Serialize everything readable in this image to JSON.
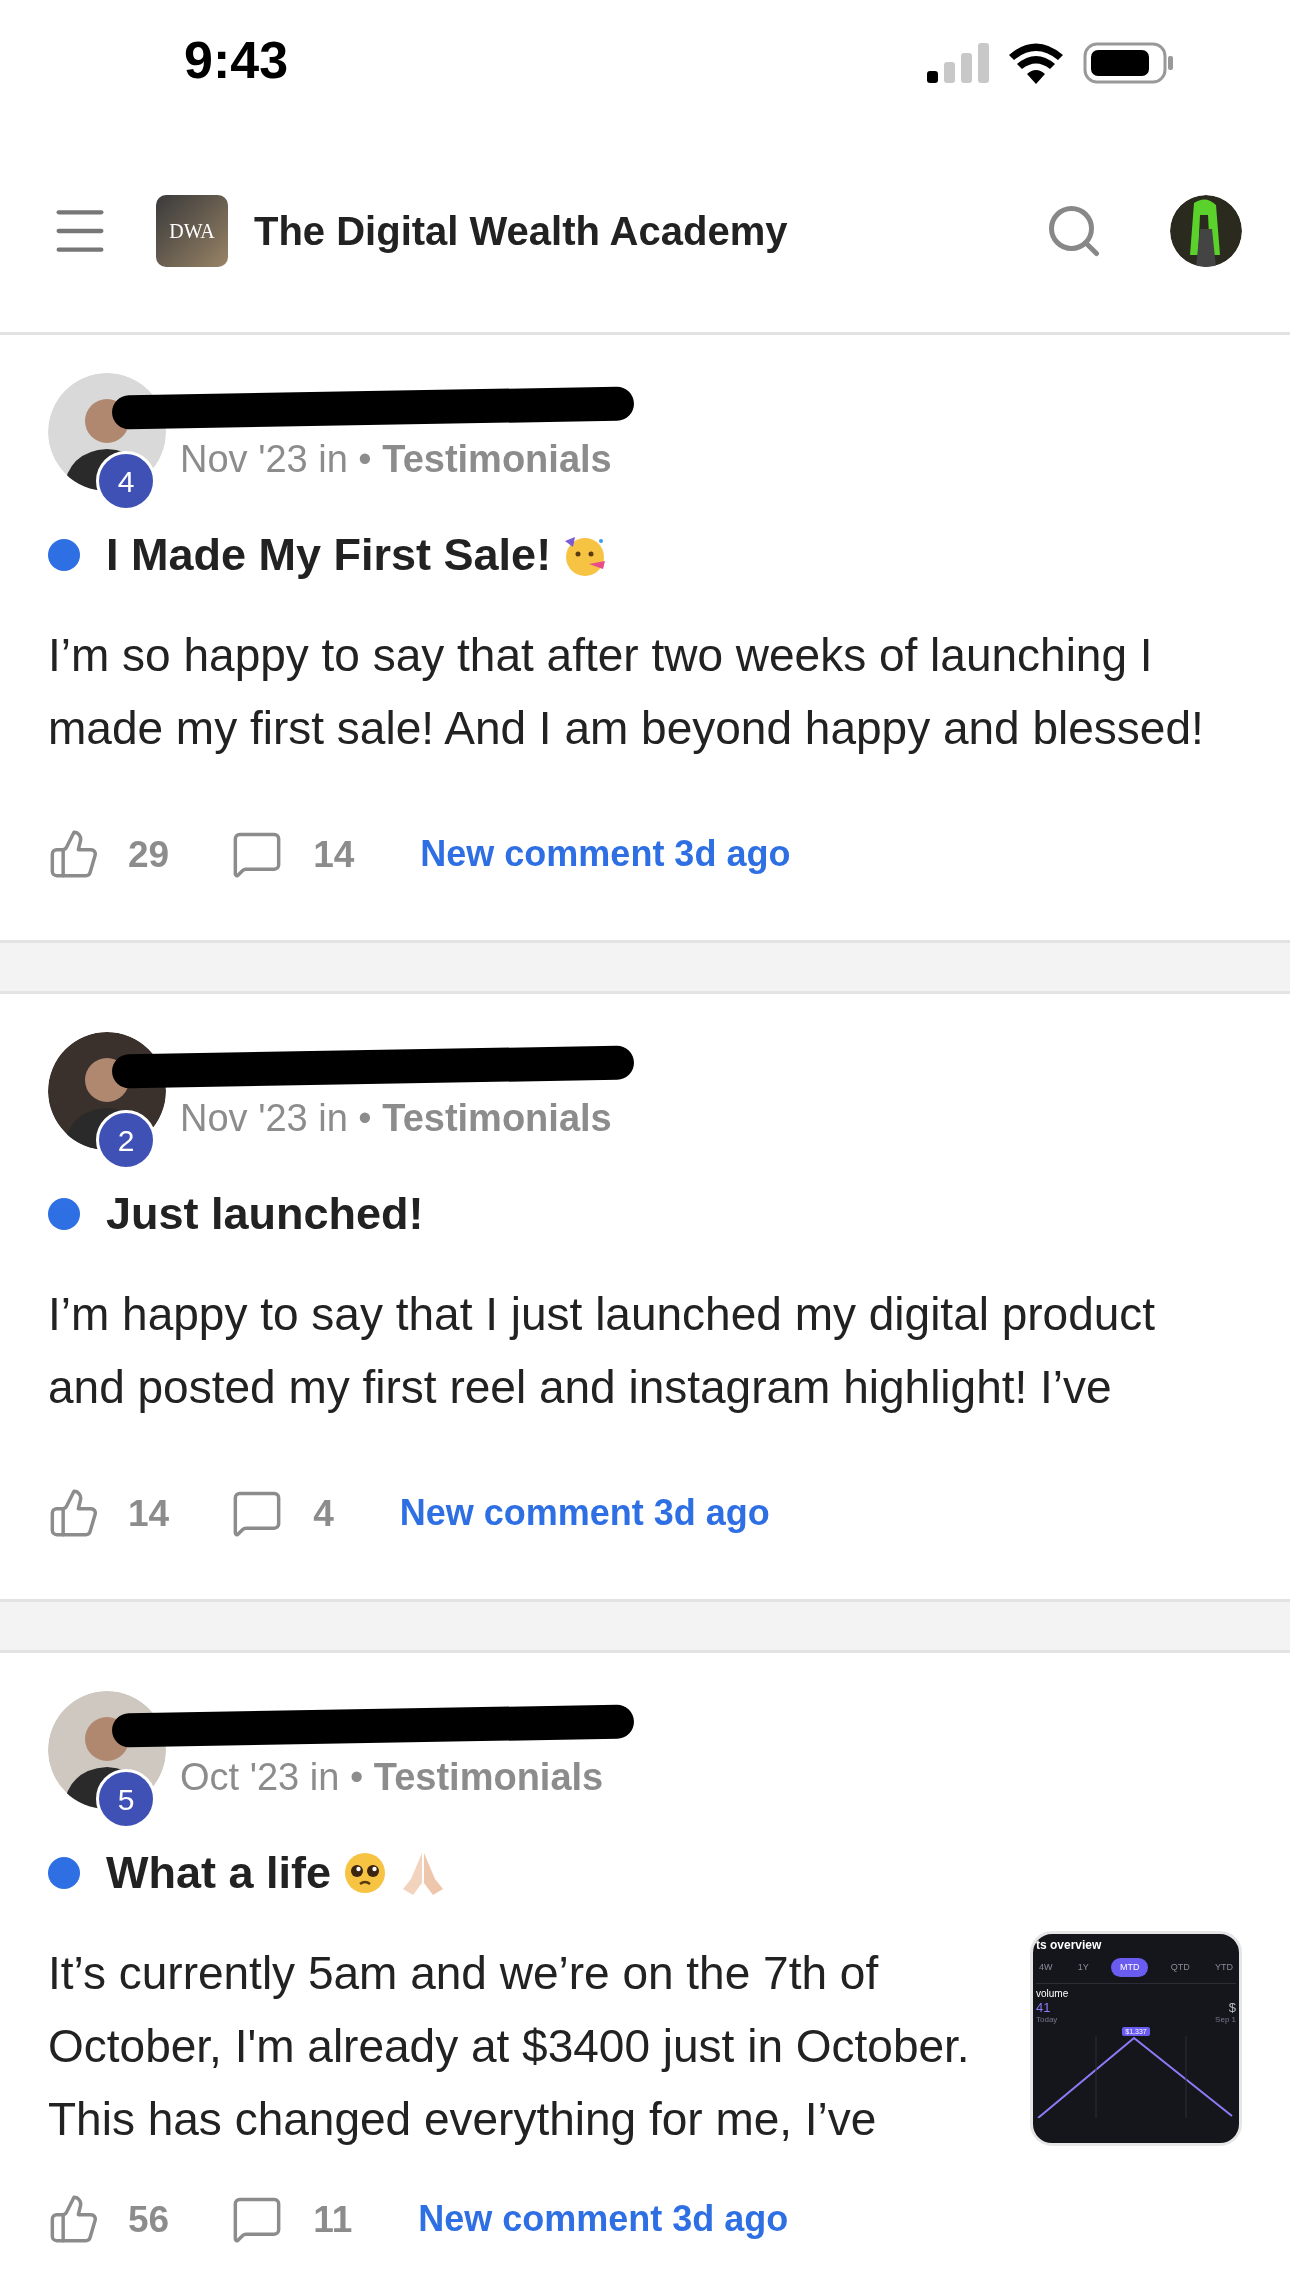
{
  "status_bar": {
    "time": "9:43"
  },
  "header": {
    "logo_text": "DWA",
    "title": "The Digital Wealth Academy"
  },
  "posts": [
    {
      "level_badge": "4",
      "date": "Nov '23 in",
      "separator": "•",
      "category": "Testimonials",
      "unread": true,
      "title": "I Made My First Sale!",
      "title_icons": [
        {
          "kind": "party"
        }
      ],
      "body_lines": [
        "I’m so happy to say that after two weeks of launching I",
        "made my first sale! And I am beyond happy and blessed!"
      ],
      "likes": "29",
      "comments": "14",
      "activity": "New comment 3d ago"
    },
    {
      "level_badge": "2",
      "date": "Nov '23 in",
      "separator": "•",
      "category": "Testimonials",
      "unread": true,
      "title": "Just launched!",
      "body_lines": [
        "I’m happy to say that I just launched my digital product",
        "and posted my first reel and instagram highlight! I’ve"
      ],
      "likes": "14",
      "comments": "4",
      "activity": "New comment 3d ago"
    },
    {
      "level_badge": "5",
      "date": "Oct '23 in",
      "separator": "•",
      "category": "Testimonials",
      "unread": true,
      "title": "What a life",
      "title_icons": [
        {
          "kind": "pleading"
        },
        {
          "kind": "praying"
        }
      ],
      "body_lines": [
        "It’s currently 5am and we’re on the 7th of",
        "October, I'm already at $3400 just in October.",
        "This has changed everything for me, I’ve"
      ],
      "likes": "56",
      "comments": "11",
      "activity": "New comment 3d ago",
      "thumbnail": {
        "title": "ts overview",
        "tabs": [
          {
            "label": "4W",
            "selected": false
          },
          {
            "label": "1Y",
            "selected": false
          },
          {
            "label": "MTD",
            "selected": true
          },
          {
            "label": "QTD",
            "selected": false
          },
          {
            "label": "YTD",
            "selected": false
          }
        ],
        "metric_label": "volume",
        "metric_value": "41",
        "metric_date": "Today",
        "side_value": "$",
        "side_date": "Sep 1",
        "tooltip": "$1,337"
      }
    }
  ]
}
